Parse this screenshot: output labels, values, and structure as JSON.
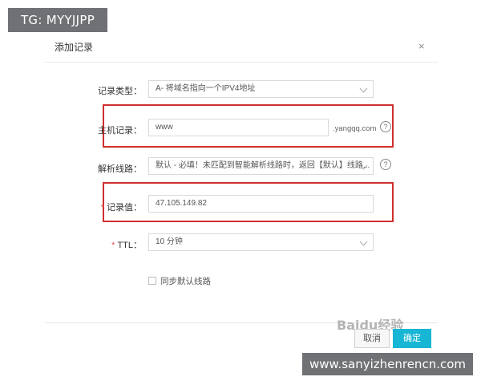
{
  "dialog": {
    "title": "添加记录",
    "close_glyph": "×"
  },
  "form": {
    "record_type": {
      "label": "记录类型：",
      "value": "A- 将域名指向一个IPV4地址"
    },
    "host": {
      "label": "主机记录：",
      "value": "www",
      "suffix": ".yangqq.com",
      "help_glyph": "?"
    },
    "line": {
      "label": "解析线路：",
      "value": "默认 - 必填！未匹配到智能解析线路时，返回【默认】线路...",
      "help_glyph": "?"
    },
    "record_value": {
      "required_mark": "*",
      "label": "记录值：",
      "value": "47.105.149.82"
    },
    "ttl": {
      "required_mark": "*",
      "label": "TTL：",
      "value": "10 分钟"
    },
    "sync_default": {
      "label": "同步默认线路",
      "checked": false
    }
  },
  "buttons": {
    "cancel": "取消",
    "confirm": "确定"
  },
  "overlays": {
    "tag": "TG: MYYJJPP",
    "site": "www.sanyizhenrencn.com",
    "watermark": "Baidu经验"
  },
  "colors": {
    "accent": "#17b6d4",
    "highlight": "#cf2f2f",
    "required": "#e55353",
    "overlay_bg": "#6f7175"
  }
}
